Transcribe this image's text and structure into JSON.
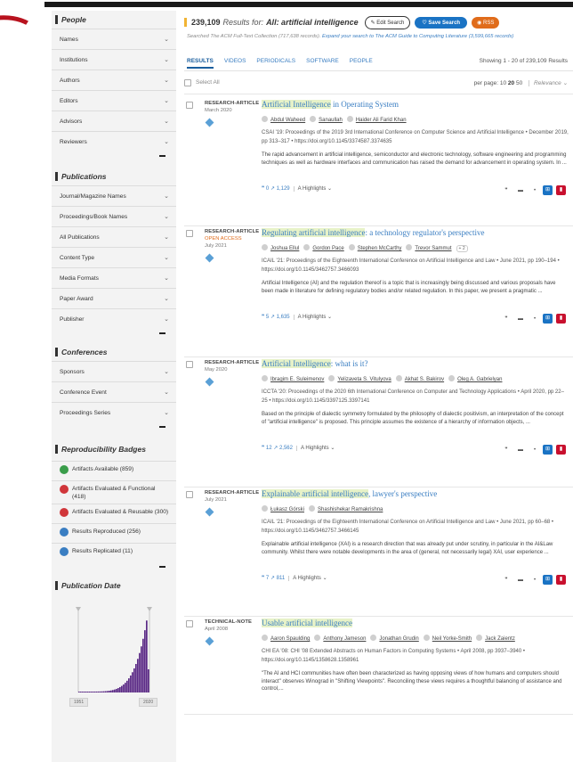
{
  "sidebar": {
    "people": {
      "title": "People",
      "rows": [
        "Names",
        "Institutions",
        "Authors",
        "Editors",
        "Advisors",
        "Reviewers"
      ]
    },
    "publications": {
      "title": "Publications",
      "rows": [
        "Journal/Magazine Names",
        "Proceedings/Book Names",
        "All Publications",
        "Content Type",
        "Media Formats",
        "Paper Award",
        "Publisher"
      ]
    },
    "conferences": {
      "title": "Conferences",
      "rows": [
        "Sponsors",
        "Conference Event",
        "Proceedings Series"
      ]
    },
    "badges": {
      "title": "Reproducibility Badges",
      "items": [
        {
          "label": "Artifacts Available (859)",
          "color": "#3a9d4a"
        },
        {
          "label": "Artifacts Evaluated & Functional (418)",
          "color": "#d0363a"
        },
        {
          "label": "Artifacts Evaluated & Reusable (300)",
          "color": "#d0363a"
        },
        {
          "label": "Results Reproduced (256)",
          "color": "#3a7ec2"
        },
        {
          "label": "Results Replicated (11)",
          "color": "#3a7ec2"
        }
      ]
    },
    "pub_date": {
      "title": "Publication Date",
      "start_year": "1951",
      "end_year": "2020"
    }
  },
  "header": {
    "count": "239,109",
    "results_for": "Results for:",
    "query": "All: artificial intelligence",
    "edit_label": "Edit Search",
    "save_label": "Save Search",
    "rss_label": "RSS",
    "searched_prefix": "Searched The ACM Full-Text Collection (717,638 records).",
    "expand_link": "Expand your search to The ACM Guide to Computing Literature (3,599,665 records)"
  },
  "tabs": {
    "items": [
      "RESULTS",
      "VIDEOS",
      "PERIODICALS",
      "SOFTWARE",
      "PEOPLE"
    ],
    "showing": "Showing 1 - 20 of 239,109 Results"
  },
  "selectbar": {
    "select_all": "Select All",
    "per_page_label": "per page:",
    "per_page_options": [
      "10",
      "20",
      "50"
    ],
    "sort": "Relevance"
  },
  "results": [
    {
      "type": "RESEARCH-ARTICLE",
      "open_access": "",
      "date": "March 2020",
      "title_hl": "Artificial Intelligence",
      "title_rest": " in Operating System",
      "authors": [
        "Abdul Waheed",
        "Sanaullah",
        "Haider Ali Farid Khan"
      ],
      "more": "",
      "venue": "CSAI '19: Proceedings of the 2019 3rd International Conference on Computer Science and Artificial Intelligence • December 2019, pp 313–317 • https://doi.org/10.1145/3374587.3374635",
      "abstract": "The rapid advancement in artificial intelligence, semiconductor and electronic technology, software engineering and programming techniques as well as hardware interfaces and communication has raised the demand for advancement in operating system. In ...",
      "citations": "0",
      "downloads": "1,129",
      "highlights": "Highlights"
    },
    {
      "type": "RESEARCH-ARTICLE",
      "open_access": "OPEN ACCESS",
      "date": "July 2021",
      "title_hl": "Regulating artificial intelligence",
      "title_rest": ": a technology regulator's perspective",
      "authors": [
        "Joshua Ellul",
        "Gordon Pace",
        "Stephen McCarthy",
        "Trevor Sammut"
      ],
      "more": "+ 2",
      "venue": "ICAIL '21: Proceedings of the Eighteenth International Conference on Artificial Intelligence and Law • June 2021, pp 190–194 • https://doi.org/10.1145/3462757.3466093",
      "abstract": "Artificial Intelligence (AI) and the regulation thereof is a topic that is increasingly being discussed and various proposals have been made in literature for defining regulatory bodies and/or related regulation. In this paper, we present a pragmatic ...",
      "citations": "5",
      "downloads": "1,635",
      "highlights": "Highlights"
    },
    {
      "type": "RESEARCH-ARTICLE",
      "open_access": "",
      "date": "May 2020",
      "title_hl": "Artificial Intelligence",
      "title_rest": ": what is it?",
      "authors": [
        "Ibragim E. Suleimenov",
        "Yelizaveta S. Vitulyova",
        "Akhat S. Bakirov",
        "Oleg A. Gabrielyan"
      ],
      "more": "",
      "venue": "ICCTA '20: Proceedings of the 2020 6th International Conference on Computer and Technology Applications • April 2020, pp 22–25 • https://doi.org/10.1145/3397125.3397141",
      "abstract": "Based on the principle of dialectic symmetry formulated by the philosophy of dialectic positivism, an interpretation of the concept of \"artificial intelligence\" is proposed. This principle assumes the existence of a hierarchy of information objects, ...",
      "citations": "12",
      "downloads": "2,562",
      "highlights": "Highlights"
    },
    {
      "type": "RESEARCH-ARTICLE",
      "open_access": "",
      "date": "July 2021",
      "title_hl": "Explainable artificial intelligence",
      "title_rest": ", lawyer's perspective",
      "authors": [
        "Łukasz Górski",
        "Shashishekar Ramakrishna"
      ],
      "more": "",
      "venue": "ICAIL '21: Proceedings of the Eighteenth International Conference on Artificial Intelligence and Law • June 2021, pp 60–68 • https://doi.org/10.1145/3462757.3466145",
      "abstract": "Explainable artificial intelligence (XAI) is a research direction that was already put under scrutiny, in particular in the AI&Law community. Whilst there were notable developments in the area of (general, not necessarily legal) XAI, user experience ...",
      "citations": "7",
      "downloads": "811",
      "highlights": "Highlights"
    },
    {
      "type": "TECHNICAL-NOTE",
      "open_access": "",
      "date": "April 2008",
      "title_hl": "Usable artificial intelligence",
      "title_rest": "",
      "authors": [
        "Aaron Spaulding",
        "Anthony Jameson",
        "Jonathan Grudin",
        "Neil Yorke-Smith",
        "Jack Zaientz"
      ],
      "more": "",
      "venue": "CHI EA '08: CHI '08 Extended Abstracts on Human Factors in Computing Systems • April 2008, pp 3937–3940 • https://doi.org/10.1145/1358628.1358961",
      "abstract": "\"The AI and HCI communities have often been characterized as having opposing views of how humans and computers should interact\" observes Winograd in \"Shifting Viewpoints\". Reconciling these views requires a thoughtful balancing of assistance and control,...",
      "citations": "",
      "downloads": "",
      "highlights": ""
    }
  ]
}
